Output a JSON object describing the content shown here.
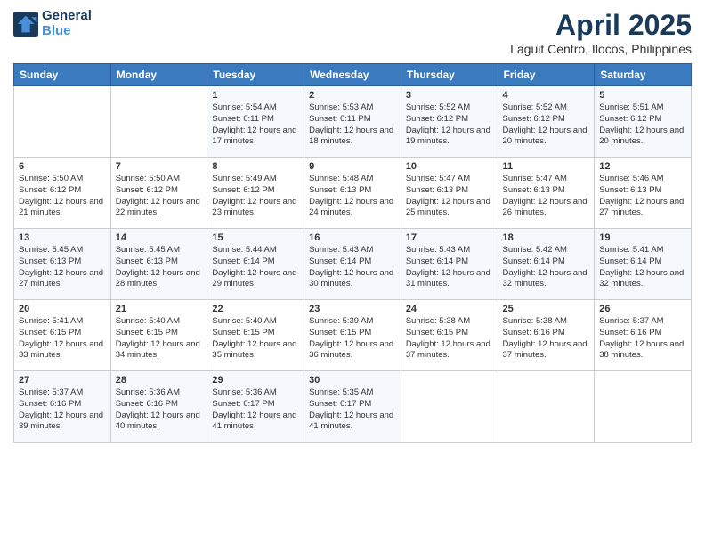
{
  "header": {
    "logo_line1": "General",
    "logo_line2": "Blue",
    "title": "April 2025",
    "subtitle": "Laguit Centro, Ilocos, Philippines"
  },
  "weekdays": [
    "Sunday",
    "Monday",
    "Tuesday",
    "Wednesday",
    "Thursday",
    "Friday",
    "Saturday"
  ],
  "weeks": [
    [
      {
        "day": "",
        "info": ""
      },
      {
        "day": "",
        "info": ""
      },
      {
        "day": "1",
        "info": "Sunrise: 5:54 AM\nSunset: 6:11 PM\nDaylight: 12 hours and 17 minutes."
      },
      {
        "day": "2",
        "info": "Sunrise: 5:53 AM\nSunset: 6:11 PM\nDaylight: 12 hours and 18 minutes."
      },
      {
        "day": "3",
        "info": "Sunrise: 5:52 AM\nSunset: 6:12 PM\nDaylight: 12 hours and 19 minutes."
      },
      {
        "day": "4",
        "info": "Sunrise: 5:52 AM\nSunset: 6:12 PM\nDaylight: 12 hours and 20 minutes."
      },
      {
        "day": "5",
        "info": "Sunrise: 5:51 AM\nSunset: 6:12 PM\nDaylight: 12 hours and 20 minutes."
      }
    ],
    [
      {
        "day": "6",
        "info": "Sunrise: 5:50 AM\nSunset: 6:12 PM\nDaylight: 12 hours and 21 minutes."
      },
      {
        "day": "7",
        "info": "Sunrise: 5:50 AM\nSunset: 6:12 PM\nDaylight: 12 hours and 22 minutes."
      },
      {
        "day": "8",
        "info": "Sunrise: 5:49 AM\nSunset: 6:12 PM\nDaylight: 12 hours and 23 minutes."
      },
      {
        "day": "9",
        "info": "Sunrise: 5:48 AM\nSunset: 6:13 PM\nDaylight: 12 hours and 24 minutes."
      },
      {
        "day": "10",
        "info": "Sunrise: 5:47 AM\nSunset: 6:13 PM\nDaylight: 12 hours and 25 minutes."
      },
      {
        "day": "11",
        "info": "Sunrise: 5:47 AM\nSunset: 6:13 PM\nDaylight: 12 hours and 26 minutes."
      },
      {
        "day": "12",
        "info": "Sunrise: 5:46 AM\nSunset: 6:13 PM\nDaylight: 12 hours and 27 minutes."
      }
    ],
    [
      {
        "day": "13",
        "info": "Sunrise: 5:45 AM\nSunset: 6:13 PM\nDaylight: 12 hours and 27 minutes."
      },
      {
        "day": "14",
        "info": "Sunrise: 5:45 AM\nSunset: 6:13 PM\nDaylight: 12 hours and 28 minutes."
      },
      {
        "day": "15",
        "info": "Sunrise: 5:44 AM\nSunset: 6:14 PM\nDaylight: 12 hours and 29 minutes."
      },
      {
        "day": "16",
        "info": "Sunrise: 5:43 AM\nSunset: 6:14 PM\nDaylight: 12 hours and 30 minutes."
      },
      {
        "day": "17",
        "info": "Sunrise: 5:43 AM\nSunset: 6:14 PM\nDaylight: 12 hours and 31 minutes."
      },
      {
        "day": "18",
        "info": "Sunrise: 5:42 AM\nSunset: 6:14 PM\nDaylight: 12 hours and 32 minutes."
      },
      {
        "day": "19",
        "info": "Sunrise: 5:41 AM\nSunset: 6:14 PM\nDaylight: 12 hours and 32 minutes."
      }
    ],
    [
      {
        "day": "20",
        "info": "Sunrise: 5:41 AM\nSunset: 6:15 PM\nDaylight: 12 hours and 33 minutes."
      },
      {
        "day": "21",
        "info": "Sunrise: 5:40 AM\nSunset: 6:15 PM\nDaylight: 12 hours and 34 minutes."
      },
      {
        "day": "22",
        "info": "Sunrise: 5:40 AM\nSunset: 6:15 PM\nDaylight: 12 hours and 35 minutes."
      },
      {
        "day": "23",
        "info": "Sunrise: 5:39 AM\nSunset: 6:15 PM\nDaylight: 12 hours and 36 minutes."
      },
      {
        "day": "24",
        "info": "Sunrise: 5:38 AM\nSunset: 6:15 PM\nDaylight: 12 hours and 37 minutes."
      },
      {
        "day": "25",
        "info": "Sunrise: 5:38 AM\nSunset: 6:16 PM\nDaylight: 12 hours and 37 minutes."
      },
      {
        "day": "26",
        "info": "Sunrise: 5:37 AM\nSunset: 6:16 PM\nDaylight: 12 hours and 38 minutes."
      }
    ],
    [
      {
        "day": "27",
        "info": "Sunrise: 5:37 AM\nSunset: 6:16 PM\nDaylight: 12 hours and 39 minutes."
      },
      {
        "day": "28",
        "info": "Sunrise: 5:36 AM\nSunset: 6:16 PM\nDaylight: 12 hours and 40 minutes."
      },
      {
        "day": "29",
        "info": "Sunrise: 5:36 AM\nSunset: 6:17 PM\nDaylight: 12 hours and 41 minutes."
      },
      {
        "day": "30",
        "info": "Sunrise: 5:35 AM\nSunset: 6:17 PM\nDaylight: 12 hours and 41 minutes."
      },
      {
        "day": "",
        "info": ""
      },
      {
        "day": "",
        "info": ""
      },
      {
        "day": "",
        "info": ""
      }
    ]
  ]
}
